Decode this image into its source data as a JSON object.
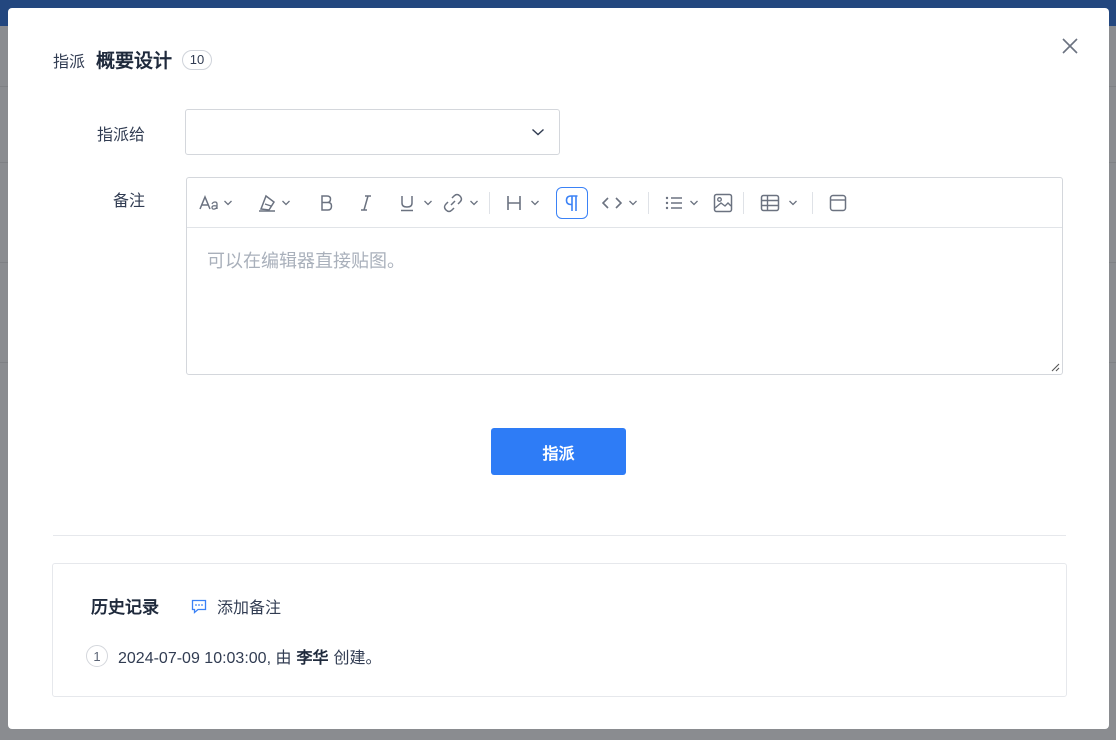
{
  "dialog": {
    "type_label": "指派",
    "title": "概要设计",
    "badge": "10"
  },
  "form": {
    "assign_label": "指派给",
    "assign_value": "",
    "note_label": "备注",
    "editor_placeholder": "可以在编辑器直接贴图。"
  },
  "toolbar": {
    "items": [
      "font-size",
      "font-color",
      "bold",
      "italic",
      "underline",
      "link",
      "heading",
      "paragraph",
      "code",
      "list",
      "image",
      "table",
      "fullscreen"
    ]
  },
  "submit": {
    "label": "指派"
  },
  "history": {
    "title": "历史记录",
    "add_note_label": "添加备注",
    "entries": [
      {
        "index": "1",
        "timestamp": "2024-07-09 10:03:00, 由",
        "user": "李华",
        "action": "创建。"
      }
    ]
  },
  "colors": {
    "primary": "#2e7cf6",
    "overlay": "#8a8c90",
    "topbar": "#23477f"
  }
}
